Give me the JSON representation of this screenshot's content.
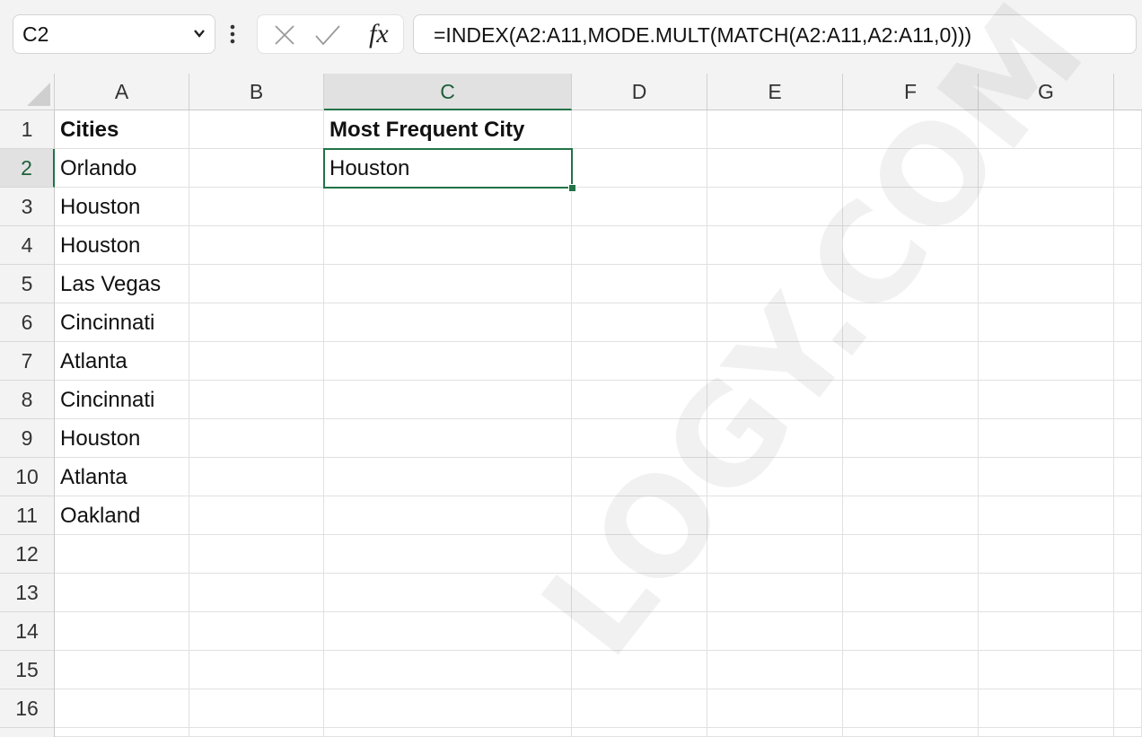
{
  "formula_bar": {
    "name_box": "C2",
    "formula": "=INDEX(A2:A11,MODE.MULT(MATCH(A2:A11,A2:A11,0)))",
    "fx_label": "fx"
  },
  "columns": [
    "A",
    "B",
    "C",
    "D",
    "E",
    "F",
    "G"
  ],
  "selected_column": "C",
  "rows": [
    "1",
    "2",
    "3",
    "4",
    "5",
    "6",
    "7",
    "8",
    "9",
    "10",
    "11",
    "12",
    "13",
    "14",
    "15",
    "16"
  ],
  "selected_row": "2",
  "cells": {
    "A1": "Cities",
    "A2": "Orlando",
    "A3": "Houston",
    "A4": "Houston",
    "A5": "Las Vegas",
    "A6": "Cincinnati",
    "A7": "Atlanta",
    "A8": "Cincinnati",
    "A9": "Houston",
    "A10": "Atlanta",
    "A11": "Oakland",
    "C1": "Most Frequent City",
    "C2": "Houston"
  },
  "watermark": "LOGY.COM",
  "colors": {
    "accent": "#217346",
    "header_bg": "#f3f3f3",
    "gridline": "#e1e1e1"
  }
}
